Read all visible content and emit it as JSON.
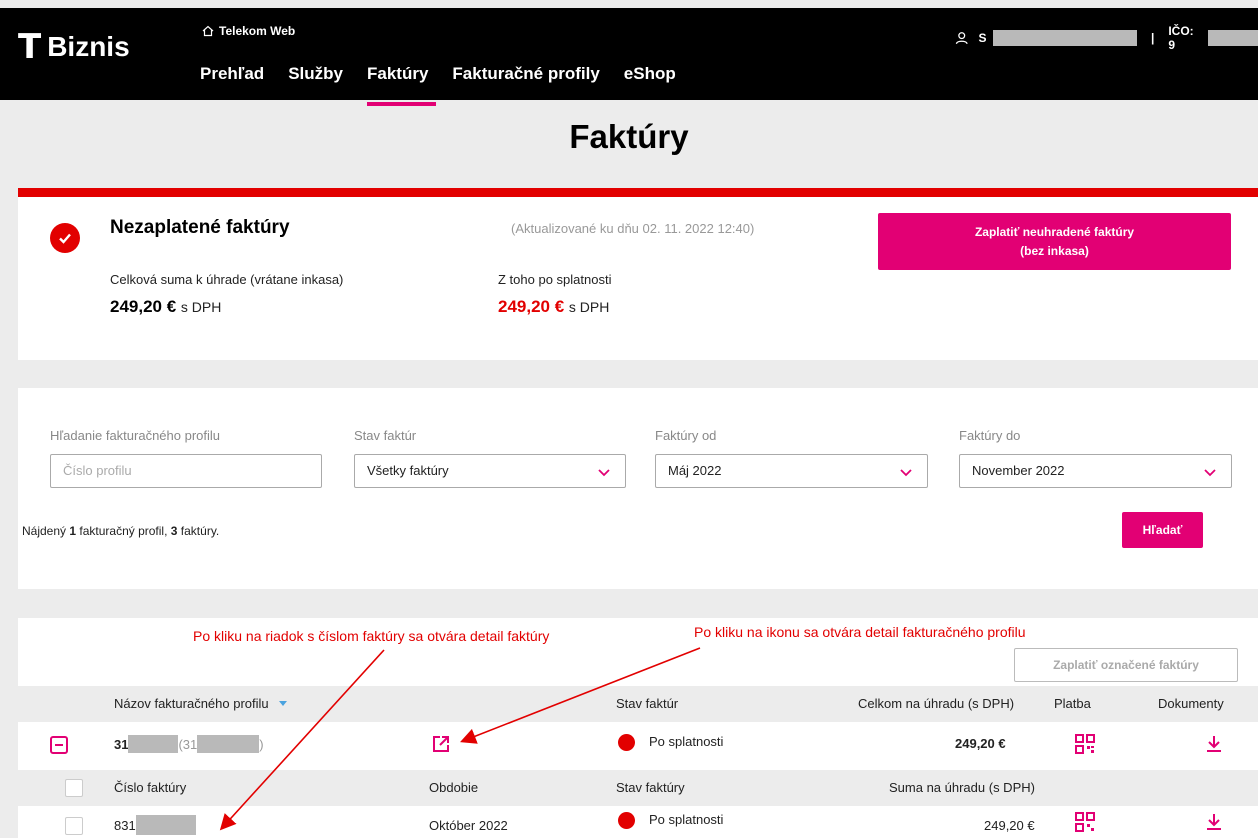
{
  "header": {
    "logo_mark": "T",
    "brand": "Biznis",
    "telekom_web": "Telekom Web",
    "nav": [
      "Prehľad",
      "Služby",
      "Faktúry",
      "Fakturačné profily",
      "eShop"
    ],
    "active_nav": "Faktúry",
    "user_prefix": "S",
    "separator": "|",
    "ico_label": "IČO: 9"
  },
  "page_title": "Faktúry",
  "summary": {
    "title": "Nezaplatené faktúry",
    "updated": "(Aktualizované ku dňu 02. 11. 2022 12:40)",
    "pay_button_line1": "Zaplatiť neuhradené faktúry",
    "pay_button_line2": "(bez inkasa)",
    "total_label": "Celková suma k úhrade (vrátane inkasa)",
    "total_value": "249,20 €",
    "overdue_label": "Z toho po splatnosti",
    "overdue_value": "249,20 €",
    "vat_suffix": "s DPH"
  },
  "filters": {
    "profile_label": "Hľadanie fakturačného profilu",
    "profile_placeholder": "Číslo profilu",
    "status_label": "Stav faktúr",
    "status_value": "Všetky faktúry",
    "from_label": "Faktúry od",
    "from_value": "Máj 2022",
    "to_label": "Faktúry do",
    "to_value": "November 2022",
    "found_prefix": "Nájdený ",
    "found_profiles": "1",
    "found_mid": " fakturačný profil, ",
    "found_invoices": "3",
    "found_suffix": " faktúry.",
    "search_button": "Hľadať"
  },
  "annotations": {
    "row_click": "Po kliku na riadok s číslom faktúry sa otvára detail faktúry",
    "icon_click": "Po kliku na ikonu sa otvára detail fakturačného profilu"
  },
  "table": {
    "pay_selected": "Zaplatiť označené faktúry",
    "columns": {
      "profile_name": "Názov fakturačného profilu",
      "status": "Stav faktúr",
      "total_due": "Celkom na úhradu (s DPH)",
      "payment": "Platba",
      "documents": "Dokumenty"
    },
    "profile_row": {
      "number_prefix": "31",
      "paren_prefix": "(31",
      "paren_suffix": ")",
      "status": "Po splatnosti",
      "amount": "249,20 €"
    },
    "sub_columns": {
      "invoice_number": "Číslo faktúry",
      "period": "Obdobie",
      "status": "Stav faktúry",
      "amount_due": "Suma na úhradu (s DPH)"
    },
    "invoice_rows": [
      {
        "number_prefix": "831",
        "period": "Október 2022",
        "status": "Po splatnosti",
        "amount": "249,20 €"
      }
    ]
  },
  "colors": {
    "magenta": "#e20074",
    "red": "#e20000",
    "black": "#000000",
    "grey_bg": "#ececec"
  }
}
